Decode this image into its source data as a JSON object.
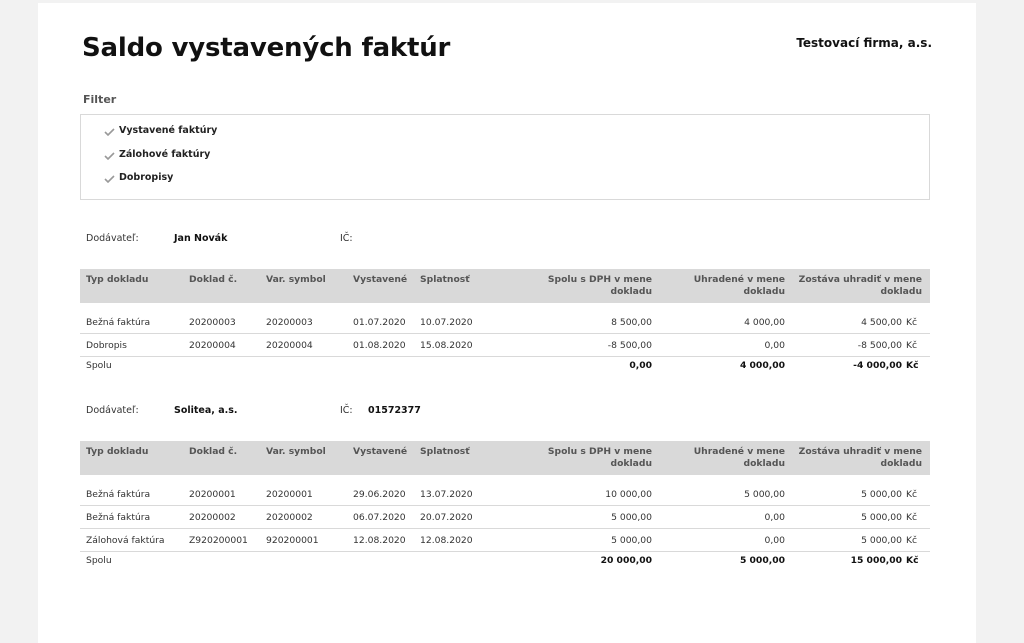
{
  "header": {
    "title": "Saldo vystavených faktúr",
    "company": "Testovací firma, a.s."
  },
  "filter": {
    "heading": "Filter",
    "items": [
      {
        "label": "Vystavené faktúry"
      },
      {
        "label": "Zálohové faktúry"
      },
      {
        "label": "Dobropisy"
      }
    ]
  },
  "columns": {
    "type": "Typ dokladu",
    "doc_no": "Doklad č.",
    "var_symbol": "Var. symbol",
    "issued": "Vystavené",
    "due": "Splatnosť",
    "total_vat": "Spolu s DPH v mene dokladu",
    "paid": "Uhradené v mene dokladu",
    "remaining": "Zostáva uhradiť v mene dokladu"
  },
  "suppliers": [
    {
      "supplier_label": "Dodávateľ:",
      "supplier_name": "Jan Novák",
      "ic_label": "IČ:",
      "ic_value": "",
      "rows": [
        {
          "type": "Bežná faktúra",
          "doc_no": "20200003",
          "var_symbol": "20200003",
          "issued": "01.07.2020",
          "due": "10.07.2020",
          "total_vat": "8 500,00",
          "paid": "4 000,00",
          "remaining": "4 500,00",
          "currency": "Kč"
        },
        {
          "type": "Dobropis",
          "doc_no": "20200004",
          "var_symbol": "20200004",
          "issued": "01.08.2020",
          "due": "15.08.2020",
          "total_vat": "-8 500,00",
          "paid": "0,00",
          "remaining": "-8 500,00",
          "currency": "Kč"
        }
      ],
      "total": {
        "label": "Spolu",
        "total_vat": "0,00",
        "paid": "4 000,00",
        "remaining": "-4 000,00",
        "currency": "Kč"
      }
    },
    {
      "supplier_label": "Dodávateľ:",
      "supplier_name": "Solitea, a.s.",
      "ic_label": "IČ:",
      "ic_value": "01572377",
      "rows": [
        {
          "type": "Bežná faktúra",
          "doc_no": "20200001",
          "var_symbol": "20200001",
          "issued": "29.06.2020",
          "due": "13.07.2020",
          "total_vat": "10 000,00",
          "paid": "5 000,00",
          "remaining": "5 000,00",
          "currency": "Kč"
        },
        {
          "type": "Bežná faktúra",
          "doc_no": "20200002",
          "var_symbol": "20200002",
          "issued": "06.07.2020",
          "due": "20.07.2020",
          "total_vat": "5 000,00",
          "paid": "0,00",
          "remaining": "5 000,00",
          "currency": "Kč"
        },
        {
          "type": "Zálohová faktúra",
          "doc_no": "Z920200001",
          "var_symbol": "920200001",
          "issued": "12.08.2020",
          "due": "12.08.2020",
          "total_vat": "5 000,00",
          "paid": "0,00",
          "remaining": "5 000,00",
          "currency": "Kč"
        }
      ],
      "total": {
        "label": "Spolu",
        "total_vat": "20 000,00",
        "paid": "5 000,00",
        "remaining": "15 000,00",
        "currency": "Kč"
      }
    }
  ]
}
